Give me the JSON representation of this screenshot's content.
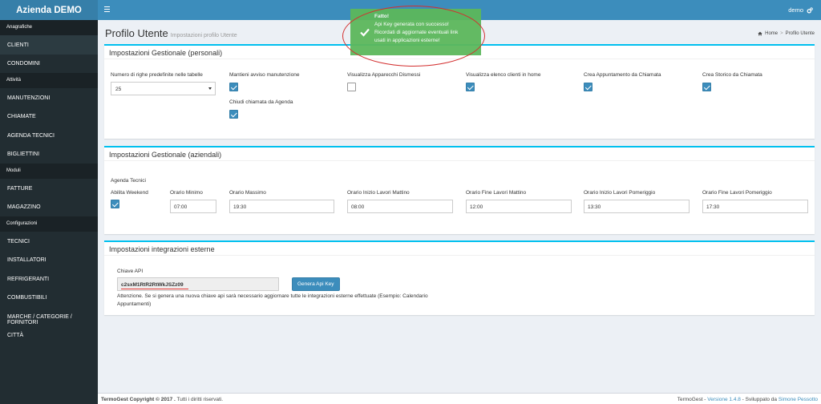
{
  "app": {
    "title": "Azienda DEMO",
    "user": "demo"
  },
  "sidebar": {
    "sections": [
      {
        "header": "Anagrafiche",
        "items": [
          "CLIENTI",
          "CONDOMINI"
        ]
      },
      {
        "header": "Attività",
        "items": [
          "MANUTENZIONI",
          "CHIAMATE",
          "AGENDA TECNICI",
          "BIGLIETTINI"
        ]
      },
      {
        "header": "Moduli",
        "items": [
          "FATTURE",
          "MAGAZZINO"
        ]
      },
      {
        "header": "Configurazioni",
        "items": [
          "TECNICI",
          "INSTALLATORI",
          "REFRIGERANTI",
          "COMBUSTIBILI",
          "MARCHE / CATEGORIE / FORNITORI",
          "CITTÀ"
        ]
      }
    ],
    "active": "CLIENTI"
  },
  "page": {
    "title": "Profilo Utente",
    "subtitle": "Impostazioni profilo Utente",
    "breadcrumb": {
      "home": "Home",
      "current": "Profilo Utente"
    }
  },
  "personali": {
    "title": "Impostazioni Gestionale (personali)",
    "righe_label": "Numero di righe predefinite nelle tabelle",
    "righe_value": "25",
    "manutenzione_label": "Mantieni avviso manutenzione",
    "manutenzione_checked": true,
    "apparecchi_label": "Visualizza Apparecchi Dismessi",
    "apparecchi_checked": false,
    "clienti_label": "Visualizza elenco clienti in home",
    "clienti_checked": true,
    "appuntamento_label": "Crea Appuntamento da Chiamata",
    "appuntamento_checked": true,
    "storico_label": "Crea Storico da Chiamata",
    "storico_checked": true,
    "chiudi_label": "Chiudi chiamata da Agenda",
    "chiudi_checked": true
  },
  "aziendali": {
    "title": "Impostazioni Gestionale (aziendali)",
    "subheader": "Agenda Tecnici",
    "weekend_label": "Abilita Weekend",
    "weekend_checked": true,
    "minimo_label": "Orario Minimo",
    "minimo_value": "07:00",
    "massimo_label": "Orario Massimo",
    "massimo_value": "19:30",
    "inizio_mattino_label": "Orario Inizio Lavori Mattino",
    "inizio_mattino_value": "08:00",
    "fine_mattino_label": "Orario Fine Lavori Mattino",
    "fine_mattino_value": "12:00",
    "inizio_pomeriggio_label": "Orario Inizio Lavori Pomeriggio",
    "inizio_pomeriggio_value": "13:30",
    "fine_pomeriggio_label": "Orario Fine Lavori Pomeriggio",
    "fine_pomeriggio_value": "17:30"
  },
  "integrazioni": {
    "title": "Impostazioni integrazioni esterne",
    "api_label": "Chiave API",
    "api_value": "c2sxM1RtR2RtWkJSZz09",
    "button": "Genera Api Key",
    "note_line1": "Attenzione. Se si genera una nuova chiave api sarà necessario aggiornare tutte le integrazioni esterne effettuate (Esempio: Calendario",
    "note_line2": "Appuntamenti)"
  },
  "toast": {
    "title": "Fatto!",
    "line1": "Api Key generata con successo!",
    "line2": "Ricordati di aggiornate eventuali link",
    "line3": "usati in applicazioni esterne!"
  },
  "footer": {
    "copyright": "TermoGest Copyright © 2017 .",
    "rights": "Tutti i diritti riservati.",
    "product": "TermoGest -",
    "version": "Versione 1.4.8",
    "dev_prefix": "- Sviluppato da",
    "developer": "Simone Pessotto"
  },
  "colors": {
    "primary": "#3c8dbc",
    "sidebar": "#222d32",
    "success": "#5cb85c",
    "box_top": "#00c0ef"
  }
}
